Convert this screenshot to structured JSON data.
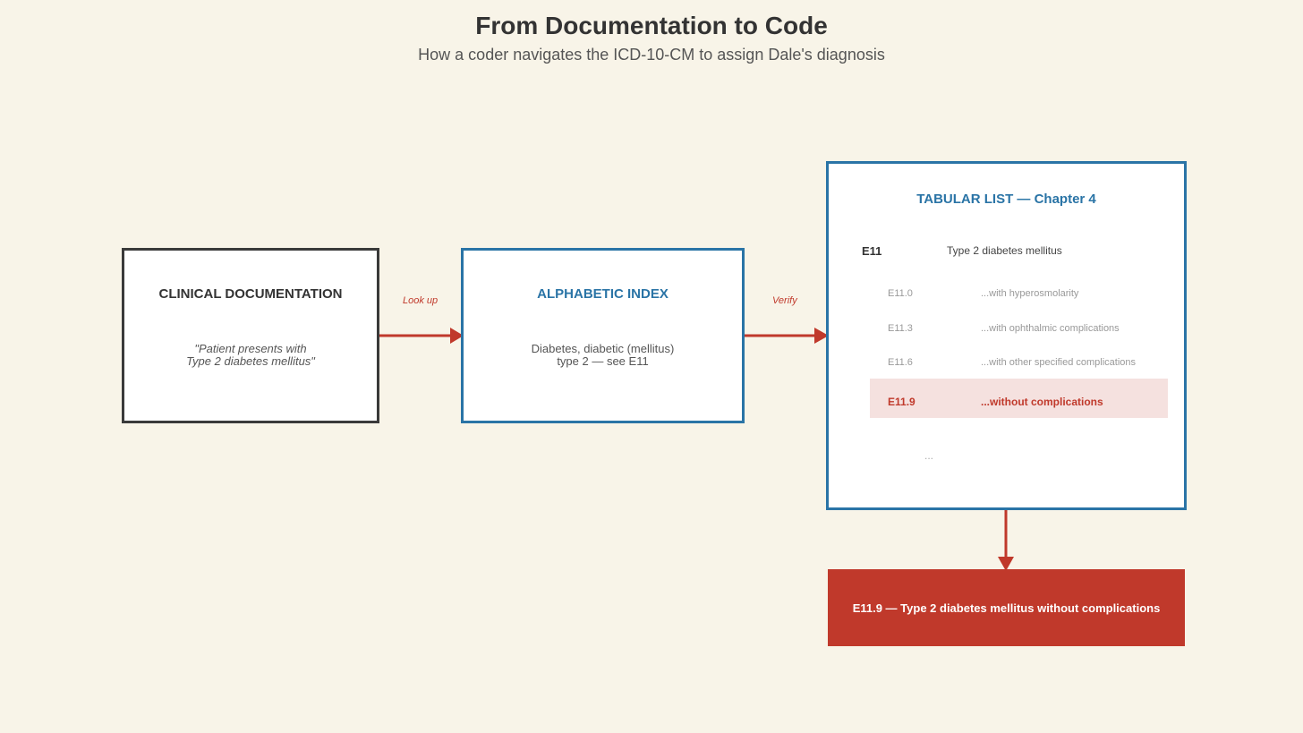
{
  "title": "From Documentation to Code",
  "subtitle": "How a coder navigates the ICD-10-CM to assign Dale's diagnosis",
  "clinical": {
    "heading": "CLINICAL DOCUMENTATION",
    "line1": "\"Patient presents with",
    "line2": "Type 2 diabetes mellitus\""
  },
  "arrow1_label": "Look up",
  "index": {
    "heading": "ALPHABETIC INDEX",
    "line1": "Diabetes, diabetic (mellitus)",
    "line2": "type 2 — see E11"
  },
  "arrow2_label": "Verify",
  "tabular": {
    "heading": "TABULAR LIST — Chapter 4",
    "parent": {
      "code": "E11",
      "desc": "Type 2 diabetes mellitus"
    },
    "children": [
      {
        "code": "E11.0",
        "desc": "...with hyperosmolarity"
      },
      {
        "code": "E11.3",
        "desc": "...with ophthalmic complications"
      },
      {
        "code": "E11.6",
        "desc": "...with other specified complications"
      },
      {
        "code": "E11.9",
        "desc": "...without complications"
      }
    ],
    "ellipsis": "..."
  },
  "result": "E11.9 — Type 2 diabetes mellitus without complications",
  "colors": {
    "background": "#f8f4e8",
    "accent_red": "#c0392b",
    "accent_blue": "#2a74a6",
    "highlight": "#f5e1df"
  }
}
